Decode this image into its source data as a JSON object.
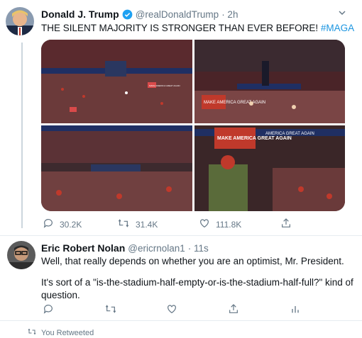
{
  "tweet1": {
    "name": "Donald J. Trump",
    "handle": "@realDonaldTrump",
    "time": "· 2h",
    "text": "THE SILENT MAJORITY IS STRONGER THAN EVER BEFORE!",
    "hashtag": "#MAGA",
    "photo_labels": [
      "MAKE AMERICA GREAT AGAIN",
      "MAKE AMERICA GREAT AGAIN",
      "AMERICA GREAT AGAIN",
      "MAKE AMERICA GREAT AGAIN"
    ],
    "counts": {
      "replies": "30.2K",
      "retweets": "31.4K",
      "likes": "111.8K"
    }
  },
  "tweet2": {
    "name": "Eric Robert Nolan",
    "handle": "@ericrnolan1",
    "time": "· 11s",
    "text1": "Well, that really depends on whether you are an optimist, Mr. President.",
    "text2": "It's sort of a \"is-the-stadium-half-empty-or-is-the-stadium-half-full?\" kind of question."
  },
  "footer": {
    "retweeted": "You Retweeted"
  },
  "colors": {
    "accent": "#1b95e0",
    "verified": "#1da1f2",
    "muted": "#657786",
    "border": "#e6ecf0"
  }
}
